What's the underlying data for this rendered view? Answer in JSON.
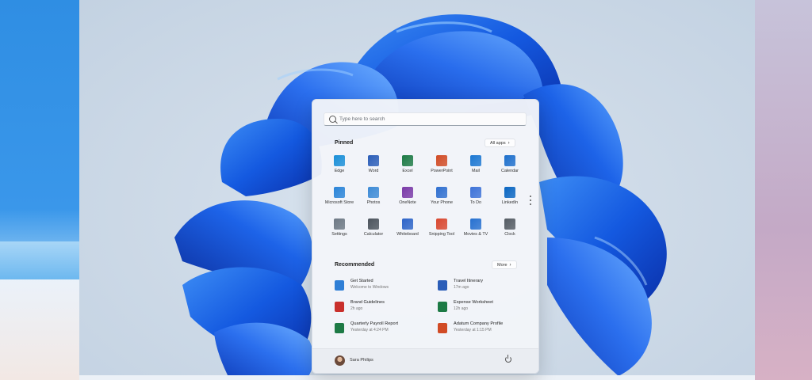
{
  "search": {
    "placeholder": "Type here to search",
    "icon": "search-icon"
  },
  "pinned": {
    "title": "Pinned",
    "all_apps_label": "All apps",
    "apps": [
      {
        "label": "Edge",
        "icon": "edge-icon",
        "color": "#1a8fd8"
      },
      {
        "label": "Word",
        "icon": "word-icon",
        "color": "#2b5db8"
      },
      {
        "label": "Excel",
        "icon": "excel-icon",
        "color": "#1d7a45"
      },
      {
        "label": "PowerPoint",
        "icon": "powerpoint-icon",
        "color": "#d14b25"
      },
      {
        "label": "Mail",
        "icon": "mail-icon",
        "color": "#1c77d2"
      },
      {
        "label": "Calendar",
        "icon": "calendar-icon",
        "color": "#1e6fcc"
      },
      {
        "label": "Microsoft Store",
        "icon": "store-icon",
        "color": "#2a84d8"
      },
      {
        "label": "Photos",
        "icon": "photos-icon",
        "color": "#3c8ad6"
      },
      {
        "label": "OneNote",
        "icon": "onenote-icon",
        "color": "#7a3aa8"
      },
      {
        "label": "Your Phone",
        "icon": "phone-icon",
        "color": "#2f6fd0"
      },
      {
        "label": "To Do",
        "icon": "todo-icon",
        "color": "#3d72d8"
      },
      {
        "label": "LinkedIn",
        "icon": "linkedin-icon",
        "color": "#0a66c2"
      },
      {
        "label": "Settings",
        "icon": "settings-icon",
        "color": "#6d7884"
      },
      {
        "label": "Calculator",
        "icon": "calculator-icon",
        "color": "#4b535c"
      },
      {
        "label": "Whiteboard",
        "icon": "whiteboard-icon",
        "color": "#2d64c8"
      },
      {
        "label": "Snipping Tool",
        "icon": "snipping-tool-icon",
        "color": "#d9472f"
      },
      {
        "label": "Movies & TV",
        "icon": "movies-tv-icon",
        "color": "#2670d0"
      },
      {
        "label": "Clock",
        "icon": "clock-icon",
        "color": "#555c64"
      }
    ]
  },
  "recommended": {
    "title": "Recommended",
    "more_label": "More",
    "items": [
      {
        "name": "Get Started",
        "sub": "Welcome to Windows",
        "icon": "get-started-icon",
        "color": "#2f7fd6"
      },
      {
        "name": "Travel Itinerary",
        "sub": "17m ago",
        "icon": "word-doc-icon",
        "color": "#2b5db8"
      },
      {
        "name": "Brand Guidelines",
        "sub": "2h ago",
        "icon": "pdf-icon",
        "color": "#c9302c"
      },
      {
        "name": "Expense Worksheet",
        "sub": "12h ago",
        "icon": "excel-doc-icon",
        "color": "#1d7a45"
      },
      {
        "name": "Quarterly Payroll Report",
        "sub": "Yesterday at 4:24 PM",
        "icon": "excel-doc-icon",
        "color": "#1d7a45"
      },
      {
        "name": "Adatum Company Profile",
        "sub": "Yesterday at 1:15 PM",
        "icon": "powerpoint-doc-icon",
        "color": "#d14b25"
      }
    ]
  },
  "user": {
    "name": "Sara Philips"
  }
}
